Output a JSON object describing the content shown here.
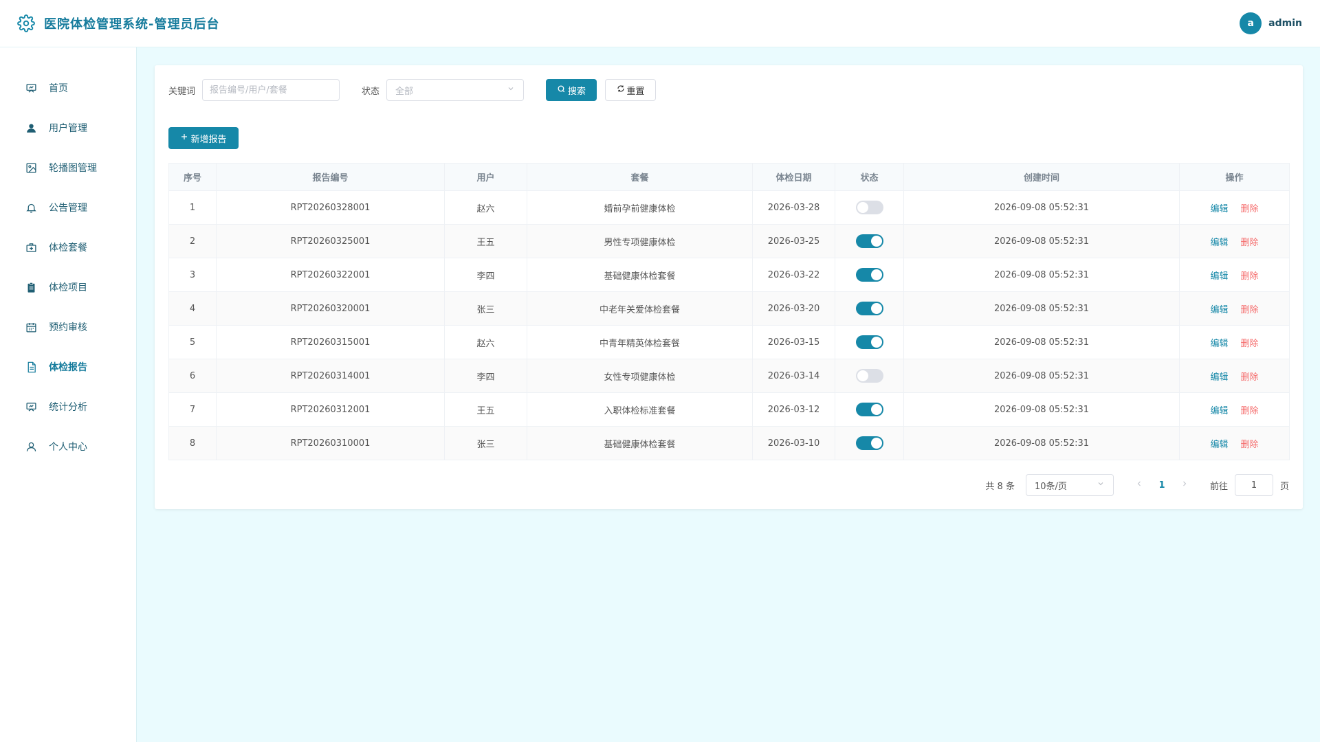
{
  "header": {
    "title": "医院体检管理系统-管理员后台",
    "avatar_letter": "a",
    "username": "admin"
  },
  "sidebar": {
    "items": [
      {
        "label": "首页",
        "icon": "home-board-icon"
      },
      {
        "label": "用户管理",
        "icon": "user-icon"
      },
      {
        "label": "轮播图管理",
        "icon": "image-icon"
      },
      {
        "label": "公告管理",
        "icon": "bell-icon"
      },
      {
        "label": "体检套餐",
        "icon": "medical-kit-icon"
      },
      {
        "label": "体检项目",
        "icon": "clipboard-icon"
      },
      {
        "label": "预约审核",
        "icon": "calendar-icon"
      },
      {
        "label": "体检报告",
        "icon": "document-icon"
      },
      {
        "label": "统计分析",
        "icon": "chart-board-icon"
      },
      {
        "label": "个人中心",
        "icon": "user-outline-icon"
      }
    ],
    "active_index": 7
  },
  "filters": {
    "keyword_label": "关键词",
    "keyword_placeholder": "报告编号/用户/套餐",
    "keyword_value": "",
    "status_label": "状态",
    "status_selected": "全部",
    "search_label": "搜索",
    "reset_label": "重置"
  },
  "toolbar": {
    "add_label": "新增报告"
  },
  "table": {
    "columns": [
      "序号",
      "报告编号",
      "用户",
      "套餐",
      "体检日期",
      "状态",
      "创建时间",
      "操作"
    ],
    "edit_label": "编辑",
    "delete_label": "删除",
    "rows": [
      {
        "index": "1",
        "report_no": "RPT20260328001",
        "user": "赵六",
        "package": "婚前孕前健康体检",
        "date": "2026-03-28",
        "status_on": false,
        "created": "2026-09-08 05:52:31"
      },
      {
        "index": "2",
        "report_no": "RPT20260325001",
        "user": "王五",
        "package": "男性专项健康体检",
        "date": "2026-03-25",
        "status_on": true,
        "created": "2026-09-08 05:52:31"
      },
      {
        "index": "3",
        "report_no": "RPT20260322001",
        "user": "李四",
        "package": "基础健康体检套餐",
        "date": "2026-03-22",
        "status_on": true,
        "created": "2026-09-08 05:52:31"
      },
      {
        "index": "4",
        "report_no": "RPT20260320001",
        "user": "张三",
        "package": "中老年关爱体检套餐",
        "date": "2026-03-20",
        "status_on": true,
        "created": "2026-09-08 05:52:31"
      },
      {
        "index": "5",
        "report_no": "RPT20260315001",
        "user": "赵六",
        "package": "中青年精英体检套餐",
        "date": "2026-03-15",
        "status_on": true,
        "created": "2026-09-08 05:52:31"
      },
      {
        "index": "6",
        "report_no": "RPT20260314001",
        "user": "李四",
        "package": "女性专项健康体检",
        "date": "2026-03-14",
        "status_on": false,
        "created": "2026-09-08 05:52:31"
      },
      {
        "index": "7",
        "report_no": "RPT20260312001",
        "user": "王五",
        "package": "入职体检标准套餐",
        "date": "2026-03-12",
        "status_on": true,
        "created": "2026-09-08 05:52:31"
      },
      {
        "index": "8",
        "report_no": "RPT20260310001",
        "user": "张三",
        "package": "基础健康体检套餐",
        "date": "2026-03-10",
        "status_on": true,
        "created": "2026-09-08 05:52:31"
      }
    ]
  },
  "pagination": {
    "total_text": "共 8 条",
    "page_size": "10条/页",
    "current_page": "1",
    "goto_label": "前往",
    "goto_value": "1",
    "page_suffix": "页"
  },
  "colors": {
    "primary": "#1688a8",
    "danger": "#f56c6c",
    "background": "#eafbfe"
  }
}
